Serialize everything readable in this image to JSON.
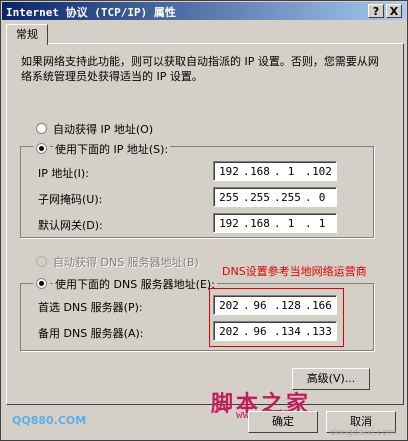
{
  "window": {
    "title": "Internet 协议 (TCP/IP) 属性",
    "help_label": "?",
    "close_label": "X"
  },
  "tabs": [
    {
      "label": "常规"
    }
  ],
  "description": "如果网络支持此功能，则可以获取自动指派的 IP 设置。否则，您需要从网络系统管理员处获得适当的 IP 设置。",
  "ip_section": {
    "auto_option": "自动获得 IP 地址(O)",
    "manual_option": "使用下面的 IP 地址(S):",
    "selected": "manual",
    "fields": [
      {
        "label": "IP 地址(I):",
        "octets": [
          "192",
          "168",
          "1",
          "102"
        ]
      },
      {
        "label": "子网掩码(U):",
        "octets": [
          "255",
          "255",
          "255",
          "0"
        ]
      },
      {
        "label": "默认网关(D):",
        "octets": [
          "192",
          "168",
          "1",
          "1"
        ]
      }
    ]
  },
  "dns_section": {
    "auto_option": "自动获得 DNS 服务器地址(B)",
    "manual_option": "使用下面的 DNS 服务器地址(E):",
    "selected": "manual",
    "fields": [
      {
        "label": "首选 DNS 服务器(P):",
        "octets": [
          "202",
          "96",
          "128",
          "166"
        ]
      },
      {
        "label": "备用 DNS 服务器(A):",
        "octets": [
          "202",
          "96",
          "134",
          "133"
        ]
      }
    ]
  },
  "annotation": "DNS设置参考当地网络运营商",
  "buttons": {
    "advanced": "高级(V)...",
    "ok": "确定",
    "cancel": "取消"
  },
  "watermarks": {
    "site_cn": "脚本之家",
    "site_url": "www.jb51.net",
    "qq": "QQ880.COM",
    "corner": "dongdaixi.com"
  },
  "colors": {
    "titlebar_start": "#0a246a",
    "titlebar_end": "#a6caf0",
    "annotation": "#e00000",
    "dialog_bg": "#d4d0c8"
  }
}
